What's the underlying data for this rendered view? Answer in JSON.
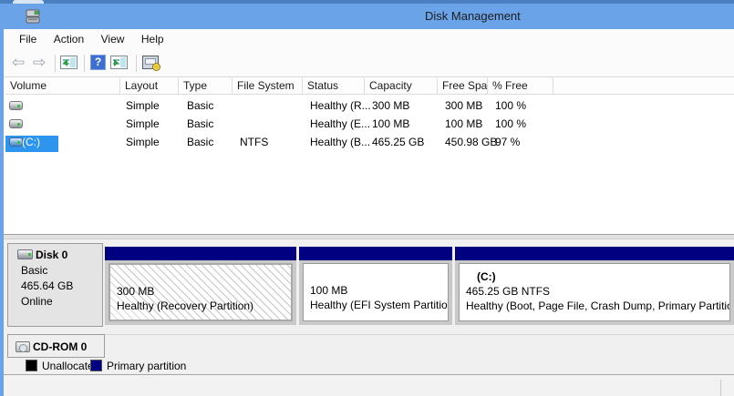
{
  "window": {
    "title": "Disk Management"
  },
  "menu": {
    "items": [
      "File",
      "Action",
      "View",
      "Help"
    ]
  },
  "toolbar": {
    "icons": [
      "back",
      "forward",
      "show-console-tree",
      "help",
      "show-action-pane",
      "disk-management-view"
    ],
    "back_glyph": "⇦",
    "forward_glyph": "⇨",
    "help_glyph": "?"
  },
  "list": {
    "columns": [
      "Volume",
      "Layout",
      "Type",
      "File System",
      "Status",
      "Capacity",
      "Free Spa...",
      "% Free"
    ],
    "rows": [
      {
        "volume": "",
        "layout": "Simple",
        "type": "Basic",
        "file_system": "",
        "status": "Healthy (R...",
        "capacity": "300 MB",
        "free_space": "300 MB",
        "pct_free": "100 %",
        "selected": false
      },
      {
        "volume": "",
        "layout": "Simple",
        "type": "Basic",
        "file_system": "",
        "status": "Healthy (E...",
        "capacity": "100 MB",
        "free_space": "100 MB",
        "pct_free": "100 %",
        "selected": false
      },
      {
        "volume": "(C:)",
        "layout": "Simple",
        "type": "Basic",
        "file_system": "NTFS",
        "status": "Healthy (B...",
        "capacity": "465.25 GB",
        "free_space": "450.98 GB",
        "pct_free": "97 %",
        "selected": true
      }
    ]
  },
  "disk0": {
    "name": "Disk 0",
    "type": "Basic",
    "size": "465.64 GB",
    "state": "Online",
    "partitions": [
      {
        "label": "",
        "size": "300 MB",
        "status": "Healthy (Recovery Partition)",
        "hatched": true
      },
      {
        "label": "",
        "size": "100 MB",
        "status": "Healthy (EFI System Partition)",
        "hatched": false
      },
      {
        "label": "(C:)",
        "size": "465.25 GB NTFS",
        "status": "Healthy (Boot, Page File, Crash Dump, Primary Partition)",
        "hatched": false
      }
    ]
  },
  "cdrom": {
    "name": "CD-ROM 0"
  },
  "legend": [
    {
      "label": "Unallocated",
      "color": "#000000"
    },
    {
      "label": "Primary partition",
      "color": "#000080"
    }
  ],
  "colors": {
    "titlebar": "#6ba3e9",
    "selection": "#2e95ef",
    "partition_bar": "#000080",
    "pane_background": "#f0f0f0"
  }
}
